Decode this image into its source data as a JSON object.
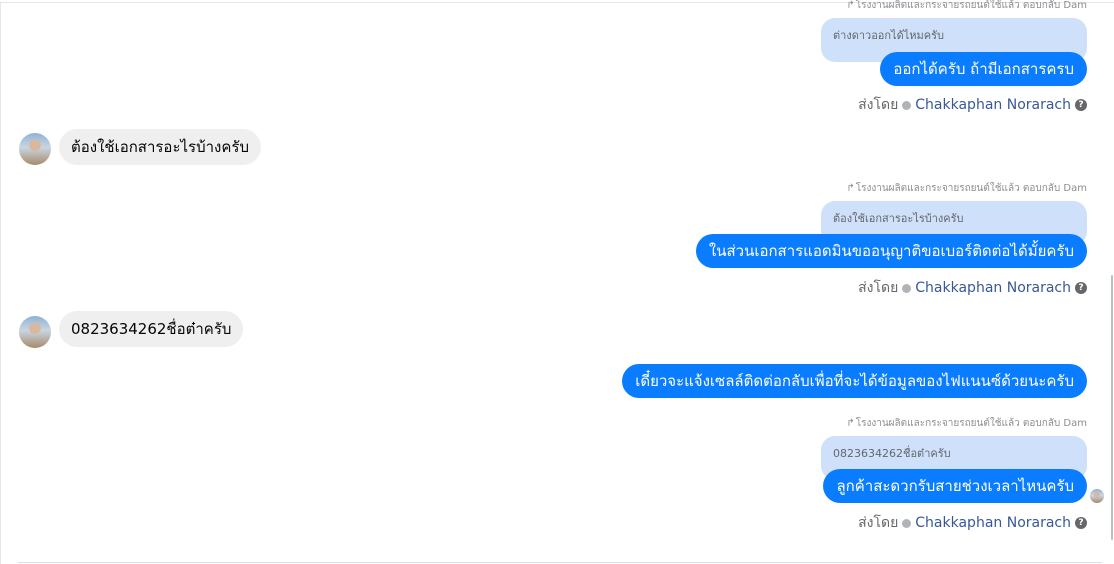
{
  "messages": {
    "reply_prefix_1": "โรงงานผลิตและกระจายรถยนต์ใช้แล้ว ตอบกลับ Dam",
    "quote_1": "ต่างดาวออกได้ไหมครับ",
    "out_1": "ออกได้ครับ ถ้ามีเอกสารครบ",
    "in_1": "ต้องใช้เอกสารอะไรบ้างครับ",
    "reply_prefix_2": "โรงงานผลิตและกระจายรถยนต์ใช้แล้ว ตอบกลับ Dam",
    "quote_2": "ต้องใช้เอกสารอะไรบ้างครับ",
    "out_2": "ในส่วนเอกสารแอดมินขออนุญาติขอเบอร์ติดต่อได้มั้ยครับ",
    "in_2": "0823634262ชื่อต๋าครับ",
    "out_3": "เดี๋ยวจะแจ้งเซลล์ติดต่อกลับเพื่อที่จะได้ข้อมูลของไฟแนนซ์ด้วยนะครับ",
    "reply_prefix_3": "โรงงานผลิตและกระจายรถยนต์ใช้แล้ว ตอบกลับ Dam",
    "quote_3": "0823634262ชื่อต๋าครับ",
    "out_4": "ลูกค้าสะดวกรับสายช่วงเวลาไหนครับ"
  },
  "sent_by": {
    "label": "ส่งโดย",
    "name": "Chakkaphan Norarach",
    "help": "?"
  },
  "icons": {
    "reply": "reply-arrow-icon",
    "verified": "verified-icon",
    "help": "help-icon"
  },
  "colors": {
    "outgoing_bubble": "#0a7cff",
    "incoming_bubble": "#efefef",
    "quoted_bubble": "#cfe0fb",
    "name_link": "#385898"
  }
}
